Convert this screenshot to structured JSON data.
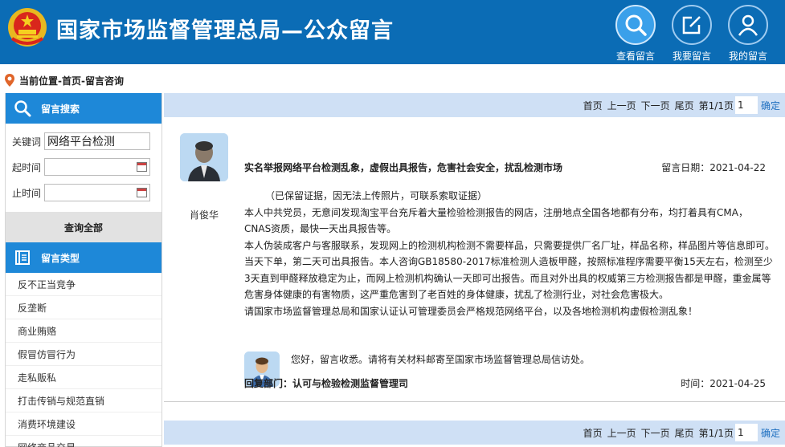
{
  "header": {
    "title": "国家市场监督管理总局—公众留言",
    "nav": [
      {
        "label": "查看留言",
        "icon": "search-icon",
        "active": true
      },
      {
        "label": "我要留言",
        "icon": "edit-icon",
        "active": false
      },
      {
        "label": "我的留言",
        "icon": "user-icon",
        "active": false
      }
    ]
  },
  "breadcrumb": "当前位置-首页-留言咨询",
  "sidebar": {
    "search_title": "留言搜索",
    "keyword_label": "关键词",
    "keyword_value": "网络平台检测",
    "start_label": "起时间",
    "end_label": "止时间",
    "query_all": "查询全部",
    "types_title": "留言类型",
    "types": [
      "反不正当竞争",
      "反垄断",
      "商业贿赂",
      "假冒仿冒行为",
      "走私贩私",
      "打击传销与规范直销",
      "消费环境建设",
      "网络商品交易"
    ]
  },
  "pager": {
    "first": "首页",
    "prev": "上一页",
    "next": "下一页",
    "last": "尾页",
    "page_info": "第1/1页",
    "page_value": "1",
    "confirm": "确定"
  },
  "post": {
    "author": "肖俊华",
    "title": "实名举报网络平台检测乱象，虚假出具报告，危害社会安全，扰乱检测市场",
    "date": "留言日期：2021-04-22",
    "paragraphs": [
      "（已保留证据，因无法上传照片，可联系索取证据）",
      "本人中共党员，无意间发现淘宝平台充斥着大量检验检测报告的网店，注册地点全国各地都有分布，均打着具有CMA，CNAS资质，最快一天出具报告等。",
      "本人伪装成客户与客服联系，发现网上的检测机构检测不需要样品，只需要提供厂名厂址，样品名称，样品图片等信息即可。当天下单，第二天可出具报告。本人咨询GB18580-2017标准检测人造板甲醛，按照标准程序需要平衡15天左右，检测至少3天直到甲醛释放稳定为止，而网上检测机构确认一天即可出报告。而且对外出具的权威第三方检测报告都是甲醛，重金属等危害身体健康的有害物质，这严重危害到了老百姓的身体健康，扰乱了检测行业，对社会危害极大。",
      "请国家市场监督管理总局和国家认证认可管理委员会严格规范网络平台，以及各地检测机构虚假检测乱象！"
    ],
    "reply_text": "您好，留言收悉。请将有关材料邮寄至国家市场监督管理总局信访处。",
    "reply_dept": "回复部门：认可与检验检测监督管理司",
    "reply_time": "时间：2021-04-25"
  },
  "colors": {
    "header_bg": "#0b6cb5",
    "accent": "#1e88d8",
    "pager_bg": "#cfe0f5"
  }
}
